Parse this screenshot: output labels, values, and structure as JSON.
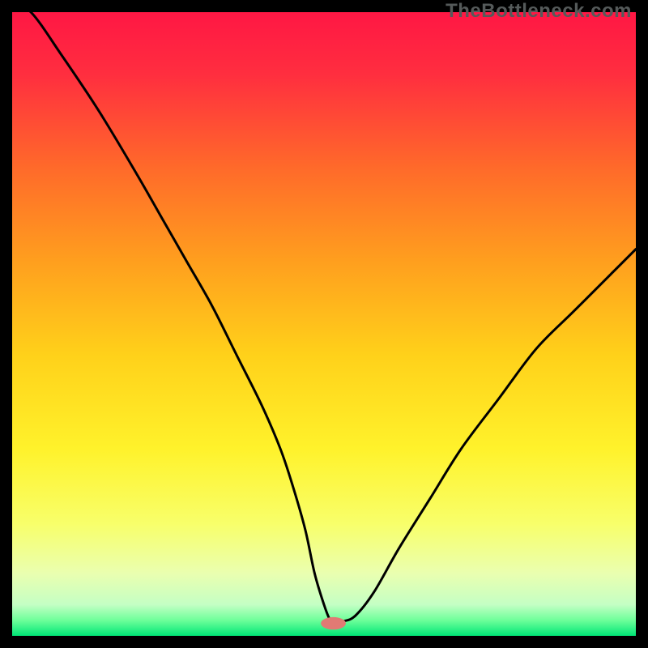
{
  "watermark": "TheBottleneck.com",
  "chart_data": {
    "type": "line",
    "title": "",
    "xlabel": "",
    "ylabel": "",
    "xlim": [
      0,
      100
    ],
    "ylim": [
      0,
      100
    ],
    "gradient_stops": [
      {
        "offset": 0.0,
        "color": "#ff1744"
      },
      {
        "offset": 0.1,
        "color": "#ff2e3f"
      },
      {
        "offset": 0.25,
        "color": "#ff6a2a"
      },
      {
        "offset": 0.4,
        "color": "#ff9f1e"
      },
      {
        "offset": 0.55,
        "color": "#ffd11a"
      },
      {
        "offset": 0.7,
        "color": "#fff22b"
      },
      {
        "offset": 0.82,
        "color": "#f8ff6a"
      },
      {
        "offset": 0.9,
        "color": "#eaffb0"
      },
      {
        "offset": 0.95,
        "color": "#c4ffc4"
      },
      {
        "offset": 0.975,
        "color": "#6eff9a"
      },
      {
        "offset": 1.0,
        "color": "#00e676"
      }
    ],
    "series": [
      {
        "name": "bottleneck-curve",
        "x": [
          0,
          3,
          8,
          14,
          20,
          24,
          28,
          32,
          36,
          40,
          43,
          45,
          47,
          48.5,
          50,
          51,
          52,
          53,
          55,
          58,
          62,
          67,
          72,
          78,
          84,
          90,
          96,
          100
        ],
        "values": [
          101,
          100,
          93,
          84,
          74,
          67,
          60,
          53,
          45,
          37,
          30,
          24,
          17,
          10,
          5,
          2.5,
          2,
          2.3,
          3.2,
          7,
          14,
          22,
          30,
          38,
          46,
          52,
          58,
          62
        ]
      }
    ],
    "marker": {
      "x": 51.5,
      "y": 2.0,
      "rx": 2.0,
      "ry": 1.0,
      "color": "#e17a74"
    }
  }
}
